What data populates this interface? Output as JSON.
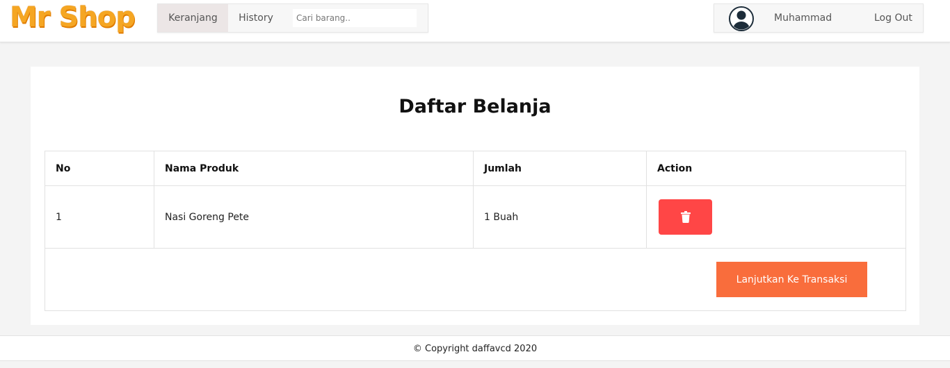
{
  "brand": {
    "logo_text": "Mr Shop",
    "color": "#f5a623"
  },
  "nav": {
    "items": [
      {
        "label": "Keranjang",
        "active": true
      },
      {
        "label": "History",
        "active": false
      }
    ],
    "search": {
      "placeholder": "Cari barang..",
      "value": ""
    }
  },
  "user": {
    "name": "Muhammad",
    "logout_label": "Log Out",
    "avatar_icon": "user-avatar-icon"
  },
  "page": {
    "title": "Daftar Belanja"
  },
  "table": {
    "headers": [
      "No",
      "Nama Produk",
      "Jumlah",
      "Action"
    ],
    "rows": [
      {
        "no": "1",
        "product": "Nasi Goreng Pete",
        "qty": "1 Buah",
        "action_icon": "trash-icon"
      }
    ]
  },
  "actions": {
    "checkout_label": "Lanjutkan Ke Transaksi"
  },
  "colors": {
    "delete": "#ff4646",
    "checkout": "#f96d3c"
  },
  "footer": {
    "text": "© Copyright daffavcd 2020"
  }
}
